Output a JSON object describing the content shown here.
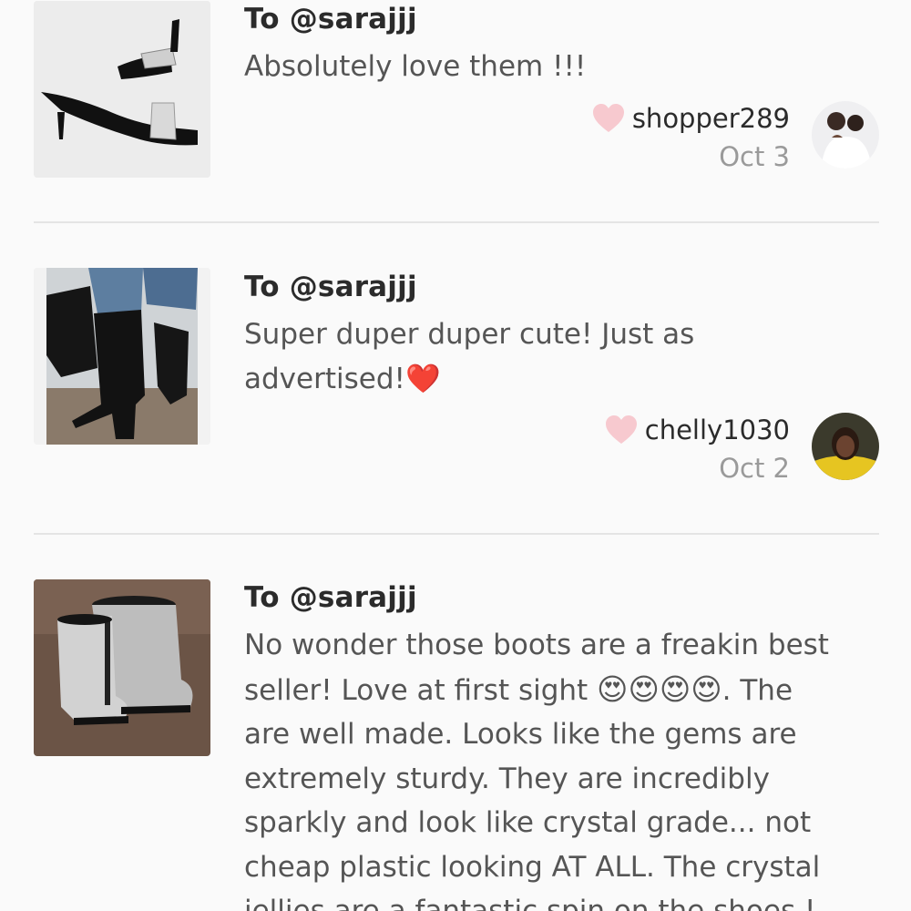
{
  "reviews": [
    {
      "to": "To @sarajjj",
      "text": "Absolutely love them !!!",
      "username": "shopper289",
      "date": "Oct 3"
    },
    {
      "to": "To @sarajjj",
      "text_line1": "Super duper duper cute! Just as",
      "text_line2": "advertised!",
      "text_emoji": "❤️",
      "username": "chelly1030",
      "date": "Oct 2"
    },
    {
      "to": "To @sarajjj",
      "text_line1": "No wonder those boots are a freakin best",
      "text_line2_a": "seller! Love at first sight ",
      "text_line2_emoji": "😍😍😍😍",
      "text_line2_b": ". The",
      "text_line3": "are well made. Looks like the gems are",
      "text_line4": "extremely sturdy. They are incredibly",
      "text_line5": "sparkly and look like crystal grade... not",
      "text_line6": "cheap plastic looking AT ALL. The crystal",
      "text_line7": "jellies are a fantastic spin on the shoes !"
    }
  ],
  "icons": {
    "like": "heart-icon",
    "like_color": "#f7c9cf"
  }
}
